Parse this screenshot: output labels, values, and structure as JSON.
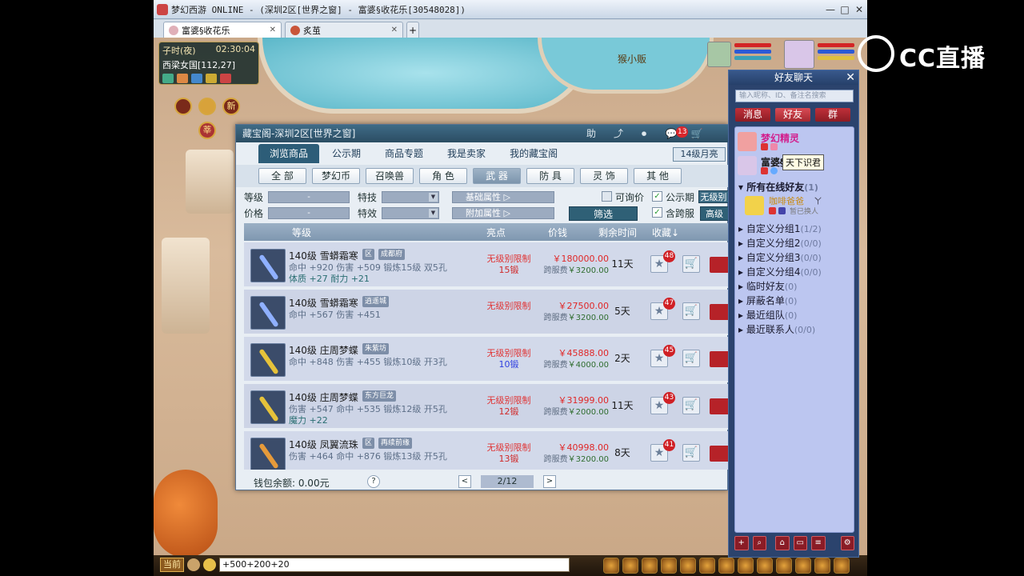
{
  "window": {
    "title": "梦幻西游 ONLINE - (深圳2区[世界之窗] - 富婆§收花乐[30548028])",
    "minimize": "—",
    "restore": "□",
    "close": "✕"
  },
  "tabs": [
    {
      "label": "富婆§收花乐",
      "close": "✕",
      "active": true
    },
    {
      "label": "炙茧",
      "close": "✕",
      "active": false
    }
  ],
  "tab_add": "+",
  "scene": {
    "npc_label": "猴小贩",
    "clock": {
      "period": "子时(夜)",
      "time": "02:30:04",
      "location": "西梁女国[112,27]"
    },
    "new_icon": "新",
    "round_icon_2": "莘"
  },
  "panel": {
    "title": "藏宝阁-深圳2区[世界之窗]",
    "header_icons": {
      "help": "助",
      "share": "⤴",
      "record": "⏺",
      "chat": "💬",
      "cart": "🛒",
      "chat_badge": "13"
    },
    "nav_tabs": [
      {
        "label": "浏览商品",
        "active": true
      },
      {
        "label": "公示期",
        "active": false
      },
      {
        "label": "商品专题",
        "active": false
      },
      {
        "label": "我是卖家",
        "active": false
      },
      {
        "label": "我的藏宝阁",
        "active": false
      }
    ],
    "level_badge": "14级月亮",
    "categories": [
      {
        "label": "全 部",
        "active": false
      },
      {
        "label": "梦幻币",
        "active": false
      },
      {
        "label": "召唤兽",
        "active": false
      },
      {
        "label": "角 色",
        "active": false
      },
      {
        "label": "武 器",
        "active": true
      },
      {
        "label": "防 具",
        "active": false
      },
      {
        "label": "灵 饰",
        "active": false
      },
      {
        "label": "其 他",
        "active": false
      }
    ],
    "filters": {
      "level_label": "等级",
      "level_value": "-",
      "price_label": "价格",
      "price_value": "-",
      "skill_label": "特技",
      "effect_label": "特效",
      "select_arrow": "▼",
      "base_attr": "基础属性",
      "extra_attr": "附加属性",
      "attr_arrow": "▷",
      "negotiable_label": "可询价",
      "negotiable_checked": false,
      "public_label": "公示期",
      "public_checked": true,
      "cross_label": "含跨服",
      "cross_checked": true,
      "check_mark": "✓",
      "no_level_btn": "无级别",
      "advanced_btn": "高级",
      "filter_btn": "筛选"
    },
    "table_headers": {
      "level": "等级",
      "highlight": "亮点",
      "price": "价钱",
      "remaining": "剩余时间",
      "favorite": "收藏↓"
    },
    "row_icons": {
      "star": "★",
      "cart": "🛒"
    },
    "items": [
      {
        "name": "140级 雪蟒霜寒",
        "tags": [
          "区",
          "成都府"
        ],
        "stat1": "命中 +920 伤害 +509 锻炼15级 双5孔",
        "stat2": "体质 +27 耐力 +21",
        "highlight": "无级别限制",
        "highlight2": "15锻",
        "highlight2_blue": false,
        "price": "￥180000.00",
        "fee_label": "跨服费",
        "fee": "￥3200.00",
        "remaining": "11天",
        "favorites": "48",
        "color": "#8fb0ff"
      },
      {
        "name": "140级 雪蟒霜寒",
        "tags": [
          "逍遥城"
        ],
        "stat1": "命中 +567 伤害 +451",
        "stat2": "",
        "highlight": "无级别限制",
        "highlight2": "",
        "highlight2_blue": false,
        "price": "￥27500.00",
        "fee_label": "跨服费",
        "fee": "￥3200.00",
        "remaining": "5天",
        "favorites": "47",
        "color": "#8fb0ff"
      },
      {
        "name": "140级 庄周梦蝶",
        "tags": [
          "朱紫坊"
        ],
        "stat1": "命中 +848 伤害 +455 锻炼10级 开3孔",
        "stat2": "",
        "highlight": "无级别限制",
        "highlight2": "10锻",
        "highlight2_blue": true,
        "price": "￥45888.00",
        "fee_label": "跨服费",
        "fee": "￥4000.00",
        "remaining": "2天",
        "favorites": "45",
        "color": "#e6c23a"
      },
      {
        "name": "140级 庄周梦蝶",
        "tags": [
          "东方巨龙"
        ],
        "stat1": "伤害 +547 命中 +535 锻炼12级 开5孔",
        "stat2": "魔力 +22",
        "highlight": "无级别限制",
        "highlight2": "12锻",
        "highlight2_blue": false,
        "price": "￥31999.00",
        "fee_label": "跨服费",
        "fee": "￥2000.00",
        "remaining": "11天",
        "favorites": "43",
        "color": "#e6c23a"
      },
      {
        "name": "140级 凤翼流珠",
        "tags": [
          "区",
          "再续前缘"
        ],
        "stat1": "伤害 +464 命中 +876 锻炼13级 开5孔",
        "stat2": "",
        "highlight": "无级别限制",
        "highlight2": "13锻",
        "highlight2_blue": false,
        "price": "￥40998.00",
        "fee_label": "跨服费",
        "fee": "￥3200.00",
        "remaining": "8天",
        "favorites": "41",
        "color": "#e69a3a"
      }
    ],
    "footer": {
      "wallet": "钱包余额: 0.00元",
      "help": "?",
      "prev": "<",
      "page": "2/12",
      "next": ">"
    }
  },
  "chat": {
    "title": "好友聊天",
    "close": "✕",
    "search_placeholder": "输入昵称、ID、备注名搜索",
    "tabs": [
      "消息",
      "好友",
      "群"
    ],
    "friends": [
      {
        "name": "梦幻精灵",
        "color": "#d21e8c"
      },
      {
        "name": "富婆§",
        "color": "#1a1a1a"
      }
    ],
    "tooltip": "天下识君",
    "online_group": "所有在线好友",
    "online_count": "(1)",
    "online_friend": {
      "name": "咖啡爸爸",
      "status": "暂已换人",
      "suffix": "ㄚ"
    },
    "groups": [
      {
        "name": "自定义分组1",
        "count": "(1/2)"
      },
      {
        "name": "自定义分组2",
        "count": "(0/0)"
      },
      {
        "name": "自定义分组3",
        "count": "(0/0)"
      },
      {
        "name": "自定义分组4",
        "count": "(0/0)"
      },
      {
        "name": "临时好友",
        "count": "(0)"
      },
      {
        "name": "屏蔽名单",
        "count": "(0)"
      },
      {
        "name": "最近组队",
        "count": "(0)"
      },
      {
        "name": "最近联系人",
        "count": "(0/0)"
      }
    ],
    "bottom_icons": [
      "+",
      "⌕",
      "⌂",
      "▭",
      "≡",
      "⚙"
    ]
  },
  "bottom": {
    "current_channel": "当前",
    "input_value": "+500+200+20"
  },
  "watermark": {
    "text": "CC直播"
  }
}
